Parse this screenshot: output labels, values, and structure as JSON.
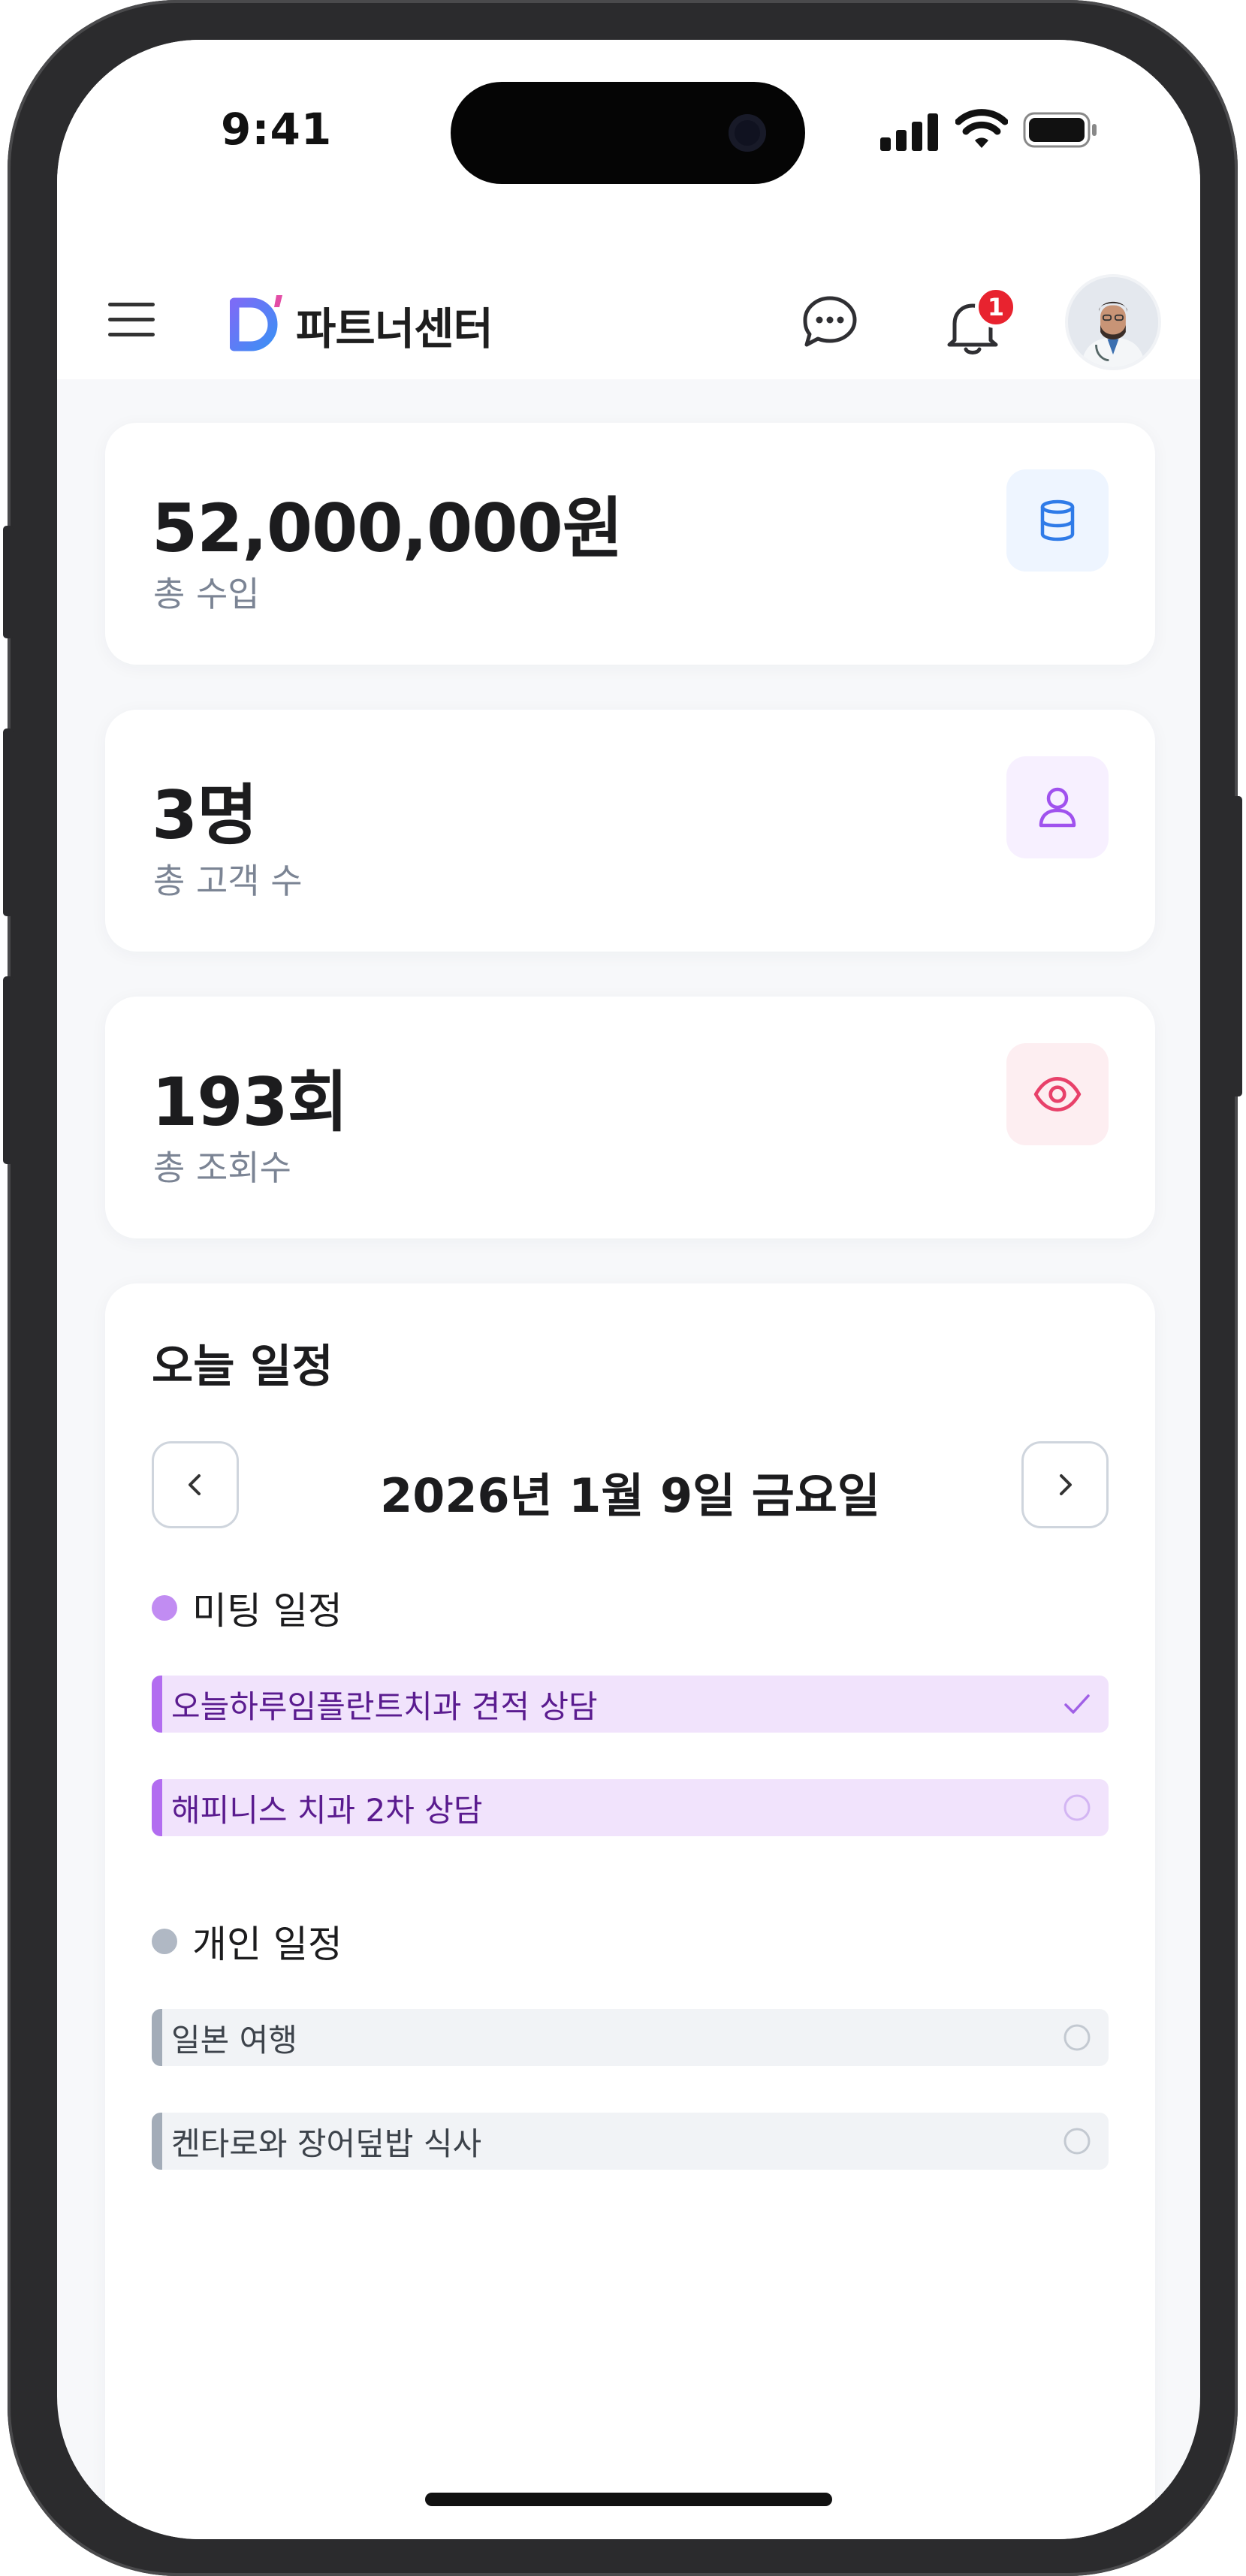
{
  "status_bar": {
    "time": "9:41"
  },
  "header": {
    "brand": "파트너센터",
    "notification_count": "1"
  },
  "stats": [
    {
      "value": "52,000,000원",
      "label": "총 수입",
      "icon": "database-icon",
      "icon_bg": "#eef5ff",
      "icon_color": "#2f7be8"
    },
    {
      "value": "3명",
      "label": "총 고객 수",
      "icon": "user-icon",
      "icon_bg": "#f7f0ff",
      "icon_color": "#a052ee"
    },
    {
      "value": "193회",
      "label": "총 조회수",
      "icon": "eye-icon",
      "icon_bg": "#fdeef1",
      "icon_color": "#e8416a"
    }
  ],
  "schedule": {
    "title": "오늘 일정",
    "date": "2026년 1월 9일 금요일",
    "sections": [
      {
        "name": "미팅 일정",
        "color": "#c18cf2",
        "events": [
          {
            "text": "오늘하루임플란트치과 견적 상담",
            "done": true
          },
          {
            "text": "해피니스 치과 2차 상담",
            "done": false
          }
        ]
      },
      {
        "name": "개인 일정",
        "color": "#b0b8c4",
        "events": [
          {
            "text": "일본 여행",
            "done": false
          },
          {
            "text": "켄타로와 장어덮밥 식사",
            "done": false
          }
        ]
      }
    ]
  }
}
